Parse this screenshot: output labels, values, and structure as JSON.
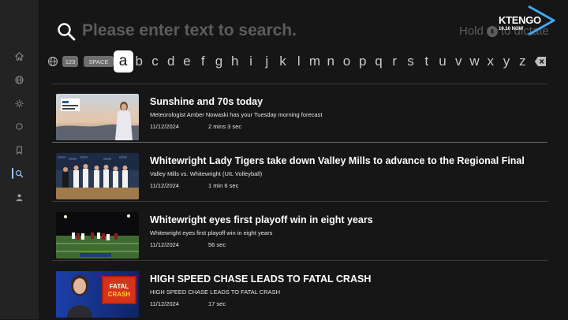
{
  "search": {
    "placeholder": "Please enter text to search.",
    "dictate_hold": "Hold",
    "dictate_rest": "to dictate"
  },
  "logo": {
    "text": "KTENGO",
    "sub": "10.10 NOW"
  },
  "sidebar": {
    "items": [
      {
        "name": "home",
        "icon": "home-icon"
      },
      {
        "name": "globe",
        "icon": "globe-icon"
      },
      {
        "name": "weather",
        "icon": "sun-icon"
      },
      {
        "name": "circle",
        "icon": "circle-icon"
      },
      {
        "name": "saved",
        "icon": "bookmark-icon"
      },
      {
        "name": "search",
        "icon": "search-icon",
        "active": true
      },
      {
        "name": "profile",
        "icon": "profile-icon"
      }
    ]
  },
  "keyboard": {
    "numbers_label": "123",
    "space_label": "SPACE",
    "selected": "a",
    "letters": [
      "a",
      "b",
      "c",
      "d",
      "e",
      "f",
      "g",
      "h",
      "i",
      "j",
      "k",
      "l",
      "m",
      "n",
      "o",
      "p",
      "q",
      "r",
      "s",
      "t",
      "u",
      "v",
      "w",
      "x",
      "y",
      "z"
    ]
  },
  "results": [
    {
      "title": "Sunshine and 70s today",
      "description": "Meteorologist Amber Nowaski has your Tuesday morning forecast",
      "date": "11/12/2024",
      "duration": "2 mins 3 sec"
    },
    {
      "title": "Whitewright Lady Tigers take down Valley Mills to advance to the Regional Final",
      "description": "Valley Mills vs. Whitewright (UIL Volleyball)",
      "date": "11/12/2024",
      "duration": "1 min 6 sec"
    },
    {
      "title": "Whitewright eyes first playoff win in eight years",
      "description": "Whitewright eyes first playoff win in eight years",
      "date": "11/12/2024",
      "duration": "56 sec"
    },
    {
      "title": "HIGH SPEED CHASE LEADS TO FATAL CRASH",
      "description": "HIGH SPEED CHASE LEADS TO FATAL CRASH",
      "date": "11/12/2024",
      "duration": "17 sec"
    }
  ],
  "thumb_text": {
    "crash_line1": "FATAL",
    "crash_line2": "CRASH"
  },
  "colors": {
    "accent": "#3fa9f5",
    "background": "#161616",
    "sidebar": "#232323",
    "muted": "#5c5c5c"
  }
}
